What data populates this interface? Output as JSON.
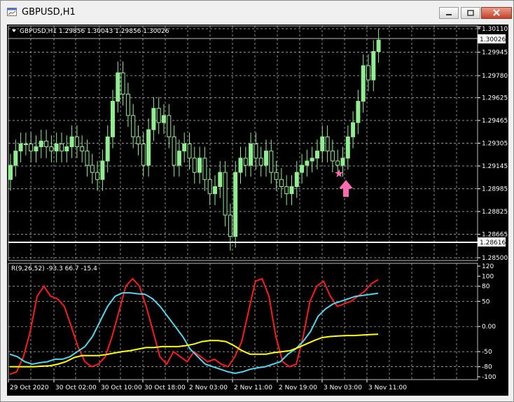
{
  "window": {
    "title": "GBPUSD,H1"
  },
  "main_chart": {
    "info": "GBPUSD,H1  1.29856 1.30043 1.29856 1.30026",
    "price_labels": [
      "1.30110",
      "1.29945",
      "1.29780",
      "1.29625",
      "1.29465",
      "1.29305",
      "1.29145",
      "1.28985",
      "1.28825",
      "1.28665",
      "1.28500"
    ],
    "current_price": "1.30026",
    "hline_price": "1.28616"
  },
  "indicator": {
    "info": "R(9,26,52) -93.3 66.7 -15.4",
    "levels": [
      "120",
      "100",
      "80",
      "50",
      "0.00",
      "-50",
      "-80",
      "-100"
    ]
  },
  "time_axis": [
    "29 Oct 2020",
    "30 Oct 02:00",
    "30 Oct 10:00",
    "30 Oct 18:00",
    "2 Nov 03:00",
    "2 Nov 11:00",
    "2 Nov 19:00",
    "3 Nov 03:00",
    "3 Nov 11:00"
  ],
  "chart_data": [
    {
      "type": "candlestick",
      "title": "GBPUSD,H1",
      "ylim": [
        1.285,
        1.3011
      ],
      "series": [
        {
          "name": "GBPUSD",
          "close": [
            1.2915,
            1.2925,
            1.293,
            1.293,
            1.2925,
            1.2928,
            1.2932,
            1.2928,
            1.2925,
            1.293,
            1.2925,
            1.2928,
            1.2935,
            1.2928,
            1.2925,
            1.2915,
            1.291,
            1.2905,
            1.2918,
            1.2935,
            1.296,
            1.298,
            1.2965,
            1.295,
            1.2935,
            1.293,
            1.2915,
            1.294,
            1.2955,
            1.2945,
            1.295,
            1.2935,
            1.2915,
            1.2925,
            1.293,
            1.292,
            1.291,
            1.292,
            1.2905,
            1.2895,
            1.29,
            1.291,
            1.288,
            1.2865,
            1.291,
            1.292,
            1.2915,
            1.293,
            1.292,
            1.2915,
            1.2925,
            1.291,
            1.2905,
            1.29,
            1.2895,
            1.29,
            1.291,
            1.2915,
            1.2918,
            1.292,
            1.2925,
            1.2935,
            1.2925,
            1.2918,
            1.2915,
            1.292,
            1.2935,
            1.2945,
            1.296,
            1.2985,
            1.2975,
            1.2995,
            1.3003
          ]
        }
      ]
    },
    {
      "type": "line",
      "title": "R(9,26,52)",
      "ylim": [
        -100,
        120
      ],
      "series": [
        {
          "name": "R(9)",
          "values": [
            -95,
            -90,
            -60,
            -10,
            60,
            80,
            60,
            55,
            40,
            0,
            -40,
            -70,
            -80,
            -75,
            -60,
            -20,
            30,
            80,
            95,
            80,
            40,
            -10,
            -60,
            -75,
            -50,
            -60,
            -70,
            -50,
            -60,
            -70,
            -65,
            -75,
            -80,
            -60,
            -30,
            30,
            90,
            95,
            60,
            -20,
            -70,
            -80,
            -75,
            -20,
            50,
            80,
            90,
            60,
            40,
            45,
            50,
            60,
            70,
            85,
            93
          ]
        },
        {
          "name": "R(26)",
          "values": [
            -55,
            -60,
            -70,
            -75,
            -72,
            -70,
            -65,
            -65,
            -60,
            -50,
            -40,
            -20,
            10,
            40,
            60,
            67,
            67,
            65,
            64,
            55,
            40,
            20,
            0,
            -20,
            -45,
            -60,
            -75,
            -80,
            -85,
            -90,
            -93,
            -90,
            -85,
            -82,
            -80,
            -75,
            -70,
            -55,
            -45,
            -30,
            -10,
            20,
            35,
            45,
            50,
            55,
            60,
            62,
            64,
            66
          ]
        },
        {
          "name": "R(52)",
          "values": [
            -80,
            -80,
            -80,
            -80,
            -79,
            -78,
            -75,
            -70,
            -62,
            -58,
            -58,
            -58,
            -56,
            -53,
            -50,
            -48,
            -45,
            -42,
            -42,
            -40,
            -40,
            -40,
            -38,
            -35,
            -30,
            -28,
            -28,
            -30,
            -38,
            -48,
            -55,
            -55,
            -55,
            -52,
            -50,
            -48,
            -42,
            -35,
            -28,
            -22,
            -20,
            -19,
            -18,
            -18,
            -17,
            -16,
            -15.4
          ]
        }
      ]
    }
  ],
  "colors": {
    "bull": "#90ee90",
    "bear": "#000000",
    "wick": "#90ee90",
    "grid": "#c0c0c0",
    "red": "#ff1a1a",
    "cyan": "#4dd8f0",
    "yellow": "#ffff00",
    "arrow": "#ff69b4"
  }
}
